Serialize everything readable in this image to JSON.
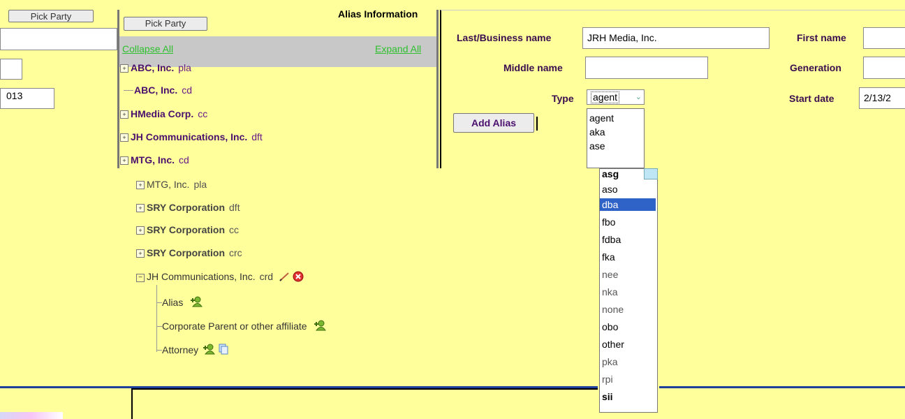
{
  "left_strip": {
    "top_button": "Pick Party",
    "date_value": "013"
  },
  "tree": {
    "pick_party_button": "Pick Party",
    "collapse_all": "Collapse All",
    "expand_all": "Expand All",
    "top_nodes": [
      {
        "name": "ABC, Inc.",
        "role": "pla"
      },
      {
        "name": "ABC, Inc.",
        "role": "cd"
      },
      {
        "name": "HMedia Corp.",
        "role": "cc"
      },
      {
        "name": "JH Communications, Inc.",
        "role": "dft"
      },
      {
        "name": "MTG, Inc.",
        "role": "cd"
      }
    ],
    "lower_nodes": [
      {
        "name": "MTG, Inc.",
        "role": "pla"
      },
      {
        "name": "SRY Corporation",
        "role": "dft"
      },
      {
        "name": "SRY Corporation",
        "role": "cc"
      },
      {
        "name": "SRY Corporation",
        "role": "crc"
      }
    ],
    "expanded_node": {
      "name": "JH Communications, Inc.",
      "role": "crd"
    },
    "children": [
      "Alias",
      "Corporate Parent or other affiliate",
      "Attorney"
    ]
  },
  "alias_form": {
    "title": "Alias Information",
    "last_name_label": "Last/Business name",
    "last_name_value": "JRH Media, Inc.",
    "first_name_label": "First name",
    "middle_name_label": "Middle name",
    "generation_label": "Generation",
    "type_label": "Type",
    "type_value": "agent",
    "start_date_label": "Start date",
    "start_date_value": "2/13/2",
    "add_alias_button": "Add Alias"
  },
  "type_dropdown": {
    "upper_options": [
      "agent",
      "aka",
      "ase"
    ],
    "lower_options": [
      "asg",
      "aso",
      "dba",
      "fbo",
      "fdba",
      "fka",
      "nee",
      "nka",
      "none",
      "obo",
      "other",
      "pka",
      "rpi",
      "sii"
    ],
    "selected": "dba"
  },
  "colors": {
    "background": "#ffff9c",
    "selection": "#3063c8",
    "link_green": "#2ec02e",
    "name_purple": "#4b0f6d"
  }
}
